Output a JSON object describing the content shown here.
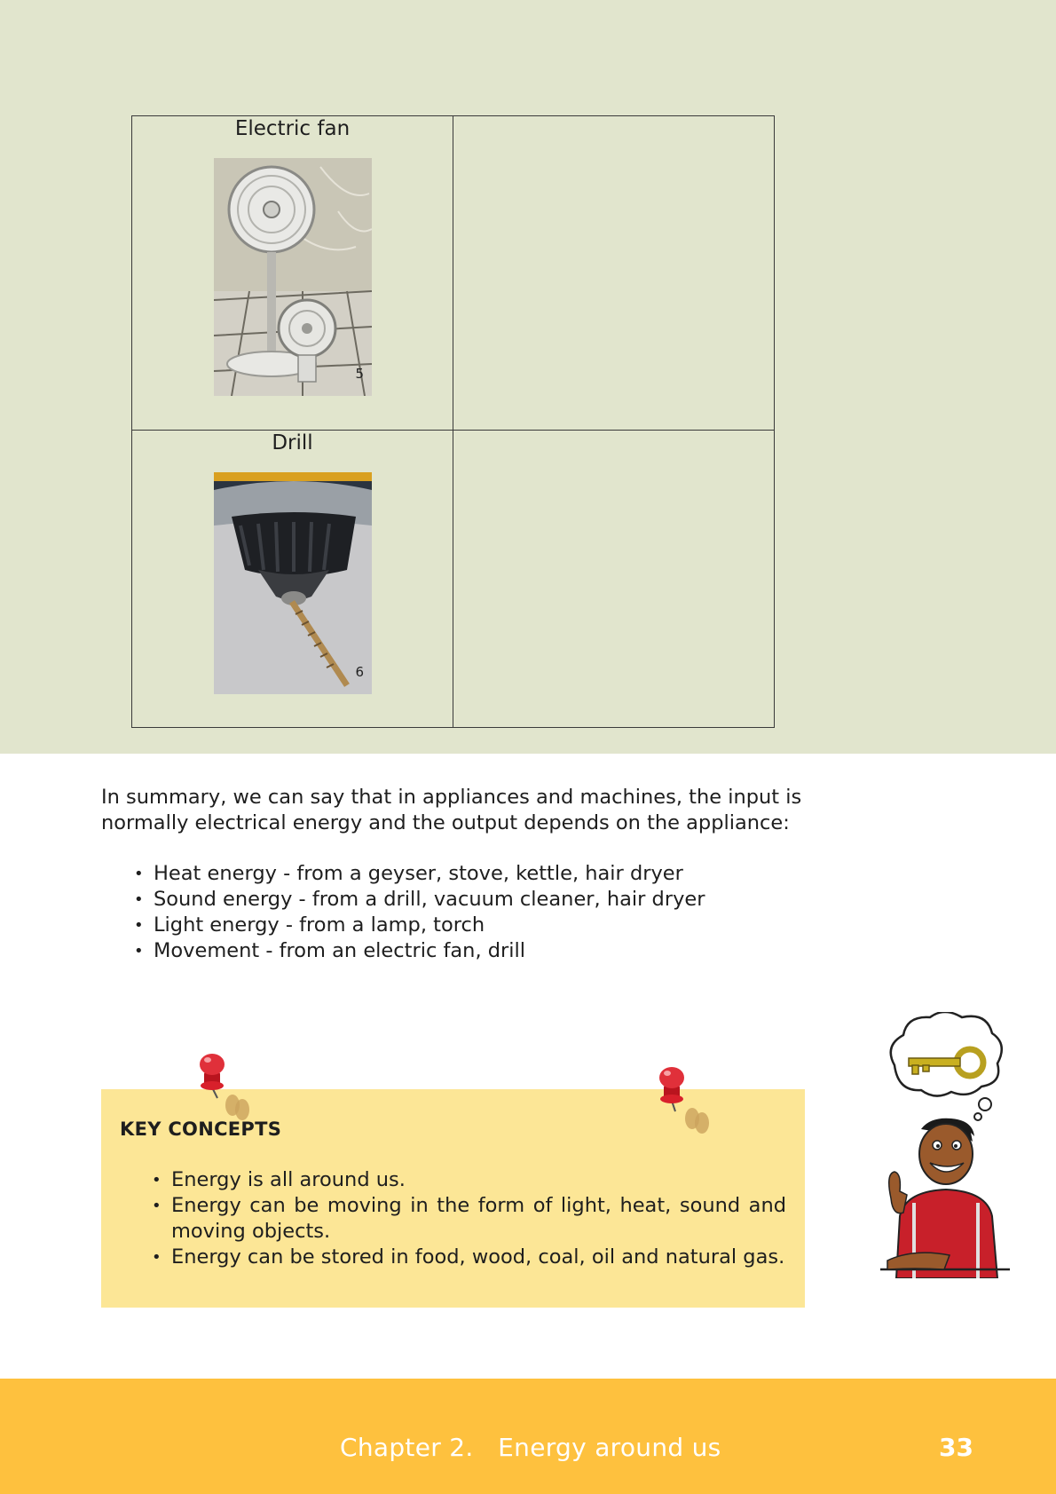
{
  "table": {
    "rows": [
      {
        "label": "Electric fan",
        "photo_number": "5"
      },
      {
        "label": "Drill",
        "photo_number": "6"
      }
    ]
  },
  "summary": {
    "intro": "In summary, we can say that in appliances and machines, the input is normally electrical energy and the output depends on the appliance:",
    "items": [
      "Heat energy - from a geyser, stove, kettle, hair dryer",
      "Sound energy - from a drill, vacuum cleaner, hair dryer",
      "Light energy - from a lamp, torch",
      "Movement - from an electric fan, drill"
    ]
  },
  "key_concepts": {
    "title": "KEY CONCEPTS",
    "items": [
      "Energy is all around us.",
      "Energy can be moving in the form of light, heat, sound and moving objects.",
      "Energy can be stored in food, wood, coal, oil and natural gas."
    ]
  },
  "footer": {
    "chapter": "Chapter 2.   Energy around us",
    "page_number": "33"
  },
  "colors": {
    "top_band": "#e1e5cd",
    "key_box": "#fce696",
    "footer": "#fec13e",
    "pin": "#d8202b"
  }
}
